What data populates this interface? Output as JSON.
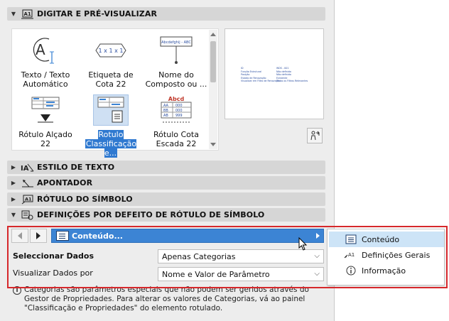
{
  "sections": {
    "digitar": "DIGITAR E PRÉ-VISUALIZAR",
    "estilo": "ESTILO DE TEXTO",
    "apontador": "APONTADOR",
    "rotulo_simbolo": "RÓTULO DO SÍMBOLO",
    "definicoes": "DEFINIÇÕES POR DEFEITO DE RÓTULO DE SÍMBOLO"
  },
  "gallery": {
    "tiles": [
      {
        "line1": "Texto / Texto",
        "line2": "Automático"
      },
      {
        "line1": "Etiqueta de",
        "line2": "Cota 22"
      },
      {
        "line1": "Nome do",
        "line2": "Composto ou ..."
      },
      {
        "line1": "Rótulo Alçado",
        "line2": "22"
      },
      {
        "line1": "Rotulo",
        "line2": "Classificação e..."
      },
      {
        "line1": "Rótulo Cota",
        "line2": "Escada 22"
      }
    ],
    "dim_text": "1 x 1 x 1",
    "composite_text": "Abcdefghij - ABC",
    "stair_top": "Abcd",
    "grid_cells": [
      "AA",
      "000",
      "BB",
      "000",
      "AB",
      "999"
    ]
  },
  "preview": {
    "col1": [
      "ID",
      "Função Estrutural",
      "Posição",
      "Estado de Renovação",
      "Visualizar em Filtro de Renovação"
    ],
    "col2": [
      "WDS - 001",
      "Não definido",
      "Não definido",
      "Existente",
      "Todos os Filtros Relevantes"
    ]
  },
  "nav": {
    "tab_label": "Conteúdo..."
  },
  "form": {
    "select_label": "Seleccionar Dados",
    "select_value": "Apenas Categorias",
    "view_label": "Visualizar Dados por",
    "view_value": "Nome e Valor de Parâmetro"
  },
  "info": {
    "line1": "Categorias são parâmetros especiais que não podem ser geridos através do",
    "line2": "Gestor de Propriedades. Para alterar os valores de Categorias, vá ao painel",
    "line3": "\"Classificação e Propriedades\" do elemento rotulado."
  },
  "popup": {
    "items": [
      {
        "label": "Conteúdo",
        "icon": "list-icon"
      },
      {
        "label": "Definições Gerais",
        "icon": "text-label-icon",
        "prefix": "A1"
      },
      {
        "label": "Informação",
        "icon": "info-icon"
      }
    ]
  },
  "colors": {
    "accent": "#3c84d4",
    "highlight": "#d6282b"
  }
}
